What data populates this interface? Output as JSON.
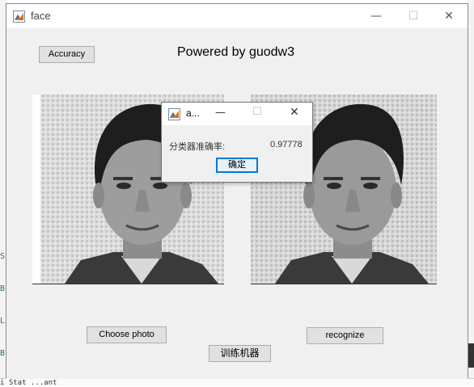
{
  "window": {
    "title": "face",
    "minimize_glyph": "—",
    "maximize_glyph": "☐",
    "close_glyph": "✕",
    "icon": "matlab-figure-icon"
  },
  "toolbar": {
    "accuracy_label": "Accuracy",
    "heading": "Powered by guodw3"
  },
  "images": {
    "left": "face-photo-original",
    "right": "face-photo-recognized"
  },
  "buttons": {
    "choose_photo": "Choose photo",
    "recognize": "recognize",
    "train": "训练机器"
  },
  "dialog": {
    "title": "a...",
    "label": "分类器准确率:",
    "value": "0.97778",
    "ok_label": "确定",
    "minimize_glyph": "—",
    "maximize_glyph": "☐",
    "close_glyph": "✕"
  },
  "background": {
    "margin_letters": [
      "S",
      "B",
      "L",
      "B",
      "i"
    ],
    "status_text": "i Stat  ...ant"
  },
  "colors": {
    "window_bg": "#f0f0f0",
    "button_bg": "#e1e1e1",
    "focus_border": "#0078d7"
  }
}
